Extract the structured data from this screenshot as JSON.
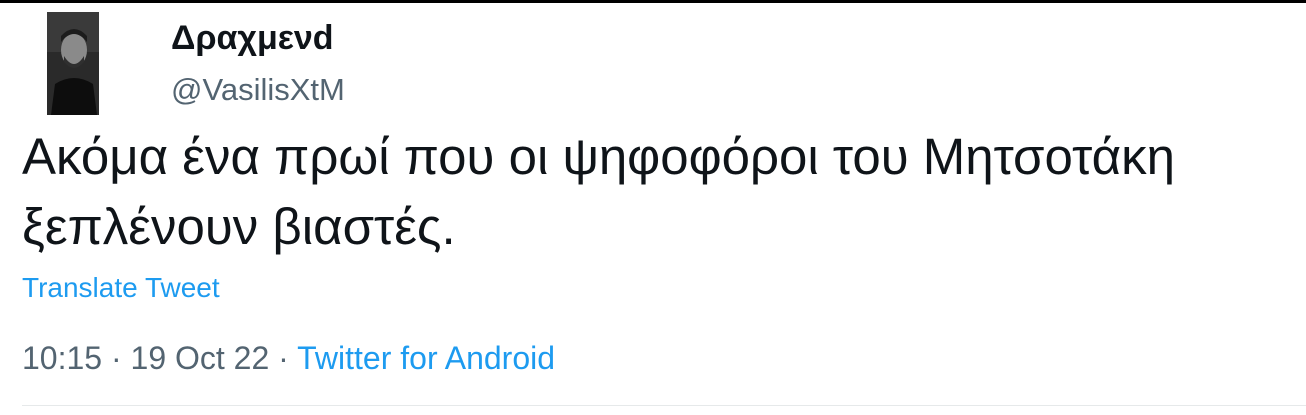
{
  "tweet": {
    "author": {
      "display_name": "Δραχμενd",
      "handle": "@VasilisXtM"
    },
    "text": "Ακόμα ένα πρωί που οι ψηφοφόροι του Μητσοτάκη ξεπλένουν βιαστές.",
    "translate_label": "Translate Tweet",
    "time": "10:15",
    "date": "19 Oct 22",
    "separator": "·",
    "source": "Twitter for Android"
  },
  "colors": {
    "link": "#1d9bf0",
    "secondary_text": "#536471",
    "primary_text": "#0f1419"
  }
}
